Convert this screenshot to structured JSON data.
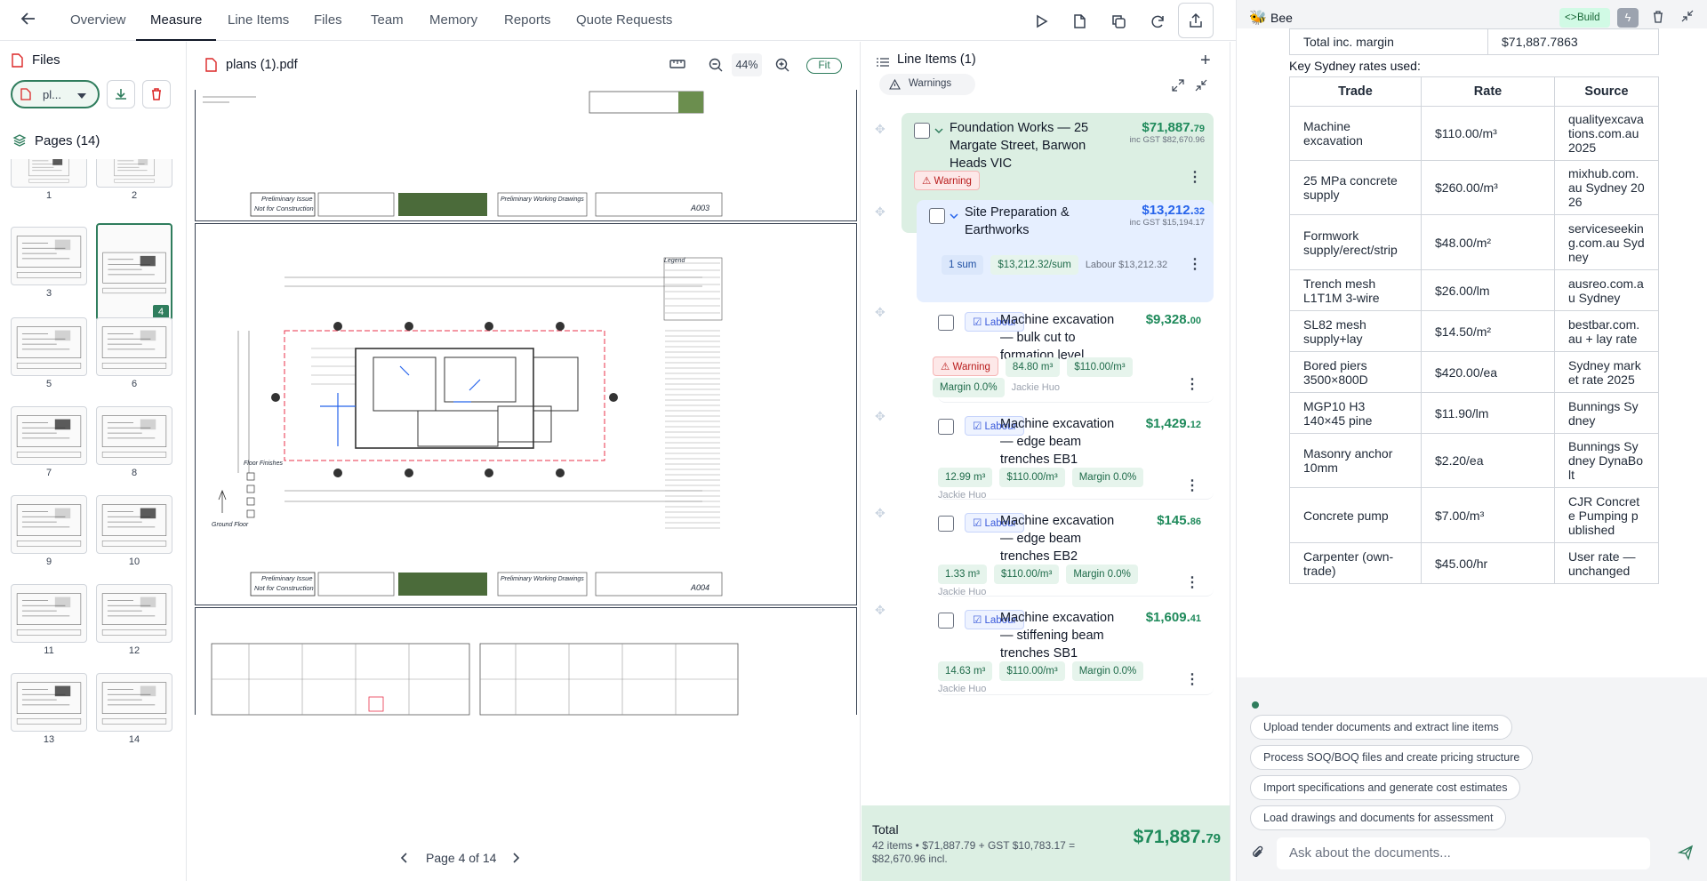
{
  "nav": {
    "tabs": [
      {
        "label": "Overview"
      },
      {
        "label": "Measure"
      },
      {
        "label": "Line Items"
      },
      {
        "label": "Files"
      },
      {
        "label": "Team"
      },
      {
        "label": "Memory"
      },
      {
        "label": "Reports"
      },
      {
        "label": "Quote Requests"
      }
    ]
  },
  "files": {
    "title": "Files",
    "selected_file": "pl...",
    "pages_title": "Pages (14)",
    "page_numbers": [
      "1",
      "2",
      "3",
      "4",
      "5",
      "6",
      "7",
      "8",
      "9",
      "10",
      "11",
      "12",
      "13",
      "14"
    ],
    "selected_page": "4"
  },
  "viewer": {
    "filename": "plans (1).pdf",
    "zoom": "44%",
    "fit_label": "Fit",
    "page_indicator": "Page 4 of 14",
    "sheet_labels": {
      "prelim_issue": "Preliminary Issue",
      "not_for_construction": "Not for Construction",
      "prelim_drawings": "Preliminary Working Drawings",
      "sheet_a003": "A003",
      "sheet_a004": "A004",
      "ground_floor": "Ground Floor",
      "floor_finishes": "Floor Finishes",
      "legend": "Legend"
    }
  },
  "line_items": {
    "title": "Line Items (1)",
    "warnings_label": "Warnings",
    "groups": [
      {
        "title": "Foundation Works — 25 Margate Street, Barwon Heads VIC",
        "price_main": "$71,887.",
        "price_cents": "79",
        "inc_gst": "inc GST $82,670.96",
        "warning": "Warning"
      }
    ],
    "subgroup": {
      "title": "Site Preparation & Earthworks",
      "price_main": "$13,212.",
      "price_cents": "32",
      "inc_gst": "inc GST $15,194.17",
      "qty": "1 sum",
      "rate": "$13,212.32/sum",
      "labour": "Labour $13,212.32"
    },
    "items": [
      {
        "tag": "Labour",
        "title": "Machine excavation — bulk cut to formation level",
        "price_main": "$9,328.",
        "price_cents": "00",
        "warning": "Warning",
        "qty": "84.80 m³",
        "rate": "$110.00/m³",
        "margin": "Margin 0.0%",
        "person": "Jackie Huo"
      },
      {
        "tag": "Labour",
        "title": "Machine excavation — edge beam trenches EB1",
        "price_main": "$1,429.",
        "price_cents": "12",
        "qty": "12.99 m³",
        "rate": "$110.00/m³",
        "margin": "Margin 0.0%",
        "person": "Jackie Huo"
      },
      {
        "tag": "Labour",
        "title": "Machine excavation — edge beam trenches EB2",
        "price_main": "$145.",
        "price_cents": "86",
        "qty": "1.33 m³",
        "rate": "$110.00/m³",
        "margin": "Margin 0.0%",
        "person": "Jackie Huo"
      },
      {
        "tag": "Labour",
        "title": "Machine excavation — stiffening beam trenches SB1",
        "price_main": "$1,609.",
        "price_cents": "41",
        "qty": "14.63 m³",
        "rate": "$110.00/m³",
        "margin": "Margin 0.0%",
        "person": "Jackie Huo"
      }
    ],
    "total": {
      "label": "Total",
      "detail": "42 items • $71,887.79 + GST $10,783.17 = $82,670.96 incl.",
      "amount_main": "$71,887.",
      "amount_cents": "79"
    }
  },
  "chat": {
    "title": "Bee",
    "build_label": "Build",
    "summary_row": {
      "label": "Total inc. margin",
      "value": "$71,887.7863"
    },
    "rates_heading": "Key Sydney rates used:",
    "table_headers": [
      "Trade",
      "Rate",
      "Source"
    ],
    "rates": [
      {
        "trade": "Machine excavation",
        "rate": "$110.00/m³",
        "source": "qualityexcavations.com.au 2025"
      },
      {
        "trade": "25 MPa concrete supply",
        "rate": "$260.00/m³",
        "source": "mixhub.com.au Sydney 2026"
      },
      {
        "trade": "Formwork supply/erect/strip",
        "rate": "$48.00/m²",
        "source": "serviceseeking.com.au Sydney"
      },
      {
        "trade": "Trench mesh L1T1M 3-wire",
        "rate": "$26.00/lm",
        "source": "ausreo.com.au Sydney"
      },
      {
        "trade": "SL82 mesh supply+lay",
        "rate": "$14.50/m²",
        "source": "bestbar.com.au + lay rate"
      },
      {
        "trade": "Bored piers 3500×800D",
        "rate": "$420.00/ea",
        "source": "Sydney market rate 2025"
      },
      {
        "trade": "MGP10 H3 140×45 pine",
        "rate": "$11.90/lm",
        "source": "Bunnings Sydney"
      },
      {
        "trade": "Masonry anchor 10mm",
        "rate": "$2.20/ea",
        "source": "Bunnings Sydney DynaBolt"
      },
      {
        "trade": "Concrete pump",
        "rate": "$7.00/m³",
        "source": "CJR Concrete Pumping published"
      },
      {
        "trade": "Carpenter (own-trade)",
        "rate": "$45.00/hr",
        "source": "User rate — unchanged"
      }
    ],
    "suggestions": [
      "Upload tender documents and extract line items",
      "Process SOQ/BOQ files and create pricing structure",
      "Import specifications and generate cost estimates",
      "Load drawings and documents for assessment"
    ],
    "input_placeholder": "Ask about the documents..."
  },
  "colors": {
    "accent": "#2f7d5d",
    "price_green": "#1f8a5b",
    "price_blue": "#2563eb",
    "warning": "#dc2626"
  }
}
